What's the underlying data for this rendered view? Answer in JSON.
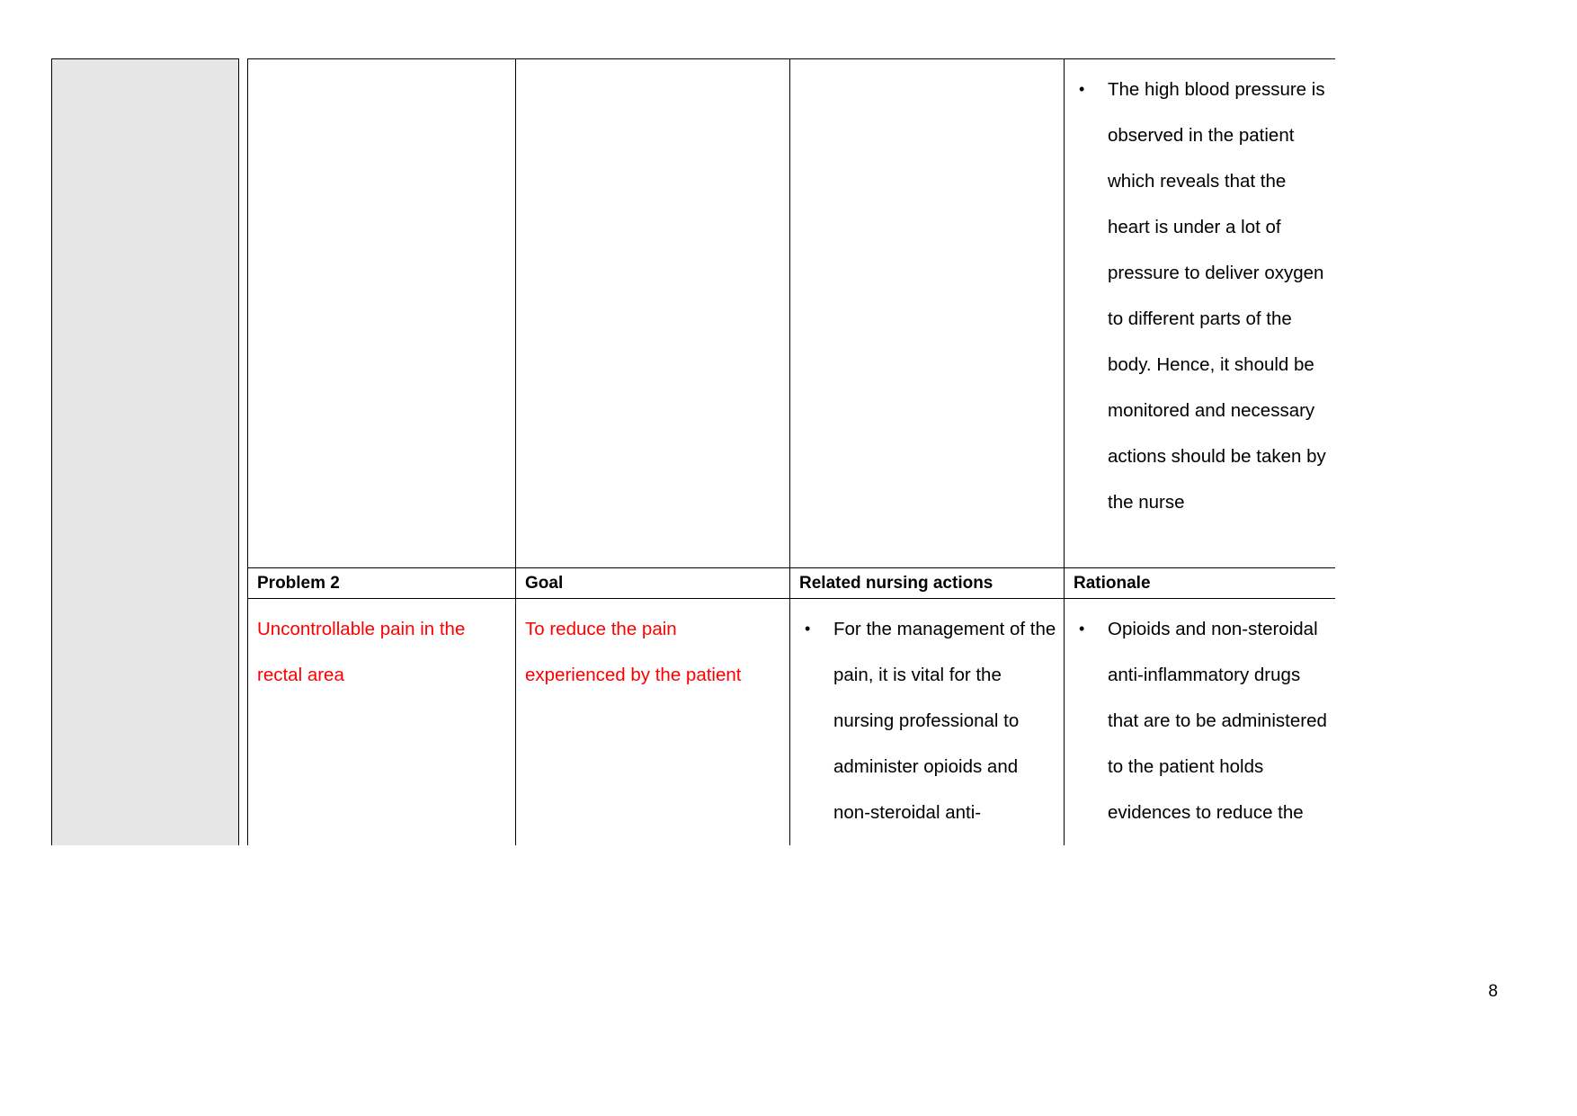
{
  "document": {
    "page_number": "8",
    "accent_red": "#ff0000",
    "gray_column_fill": "#e6e6e6"
  },
  "table": {
    "continued_row": {
      "column_1": "",
      "column_2": "",
      "column_3": "",
      "column_4_bullets": [
        "The high blood pressure is observed in the patient which reveals that the heart is under a lot of pressure to deliver oxygen to different parts of the body. Hence, it should be monitored and necessary actions should be taken by the nurse"
      ]
    },
    "headers": [
      "Problem 2",
      "Goal",
      "Related nursing actions",
      "Rationale"
    ],
    "problem2_row": {
      "problem": "Uncontrollable pain in the rectal area",
      "goal": "To reduce the pain experienced by the patient",
      "related_nursing_actions_bullets": [
        "For the management of the pain, it is vital for the nursing professional to administer opioids and non-steroidal anti-inflammatory drugs to"
      ],
      "rationale_bullets": [
        "Opioids and non-steroidal anti-inflammatory drugs that are to be administered to the patient holds evidences to reduce the"
      ]
    }
  }
}
